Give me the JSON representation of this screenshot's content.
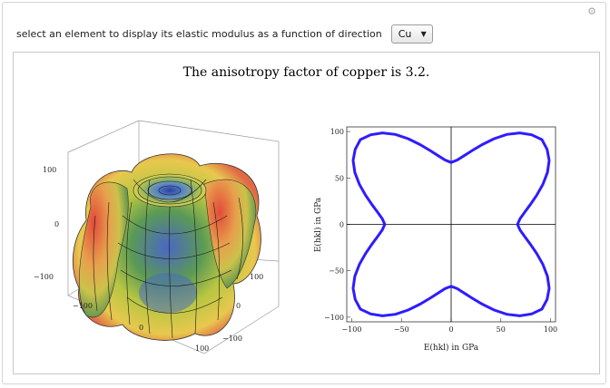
{
  "control": {
    "label": "select an element to display its elastic modulus as a function of direction",
    "element_selected": "Cu"
  },
  "icons": {
    "settings": "gear-icon",
    "dropdown": "chevron-down-icon"
  },
  "title": "The anisotropy factor of copper is 3.2.",
  "surface_plot": {
    "left_ticks": [
      "100",
      "0",
      "−100"
    ],
    "bottom_ticks": [
      "−100",
      "0",
      "100"
    ],
    "right_ticks": [
      "100",
      "0",
      "−100"
    ]
  },
  "chart_data": {
    "type": "line",
    "title": "",
    "xlabel": "E(hkl) in GPa",
    "ylabel": "E(hkl) in GPa",
    "xlim": [
      -105,
      105
    ],
    "ylim": [
      -105,
      105
    ],
    "xticks": [
      "−100",
      "−50",
      "0",
      "50",
      "100"
    ],
    "yticks": [
      "100",
      "50",
      "0",
      "−50",
      "−100"
    ],
    "series": [
      {
        "color": "#2f1cff",
        "points": [
          [
            66.7,
            0
          ],
          [
            69.3,
            6.1
          ],
          [
            73.9,
            13.0
          ],
          [
            79.6,
            21.3
          ],
          [
            86.0,
            31.3
          ],
          [
            92.2,
            43.0
          ],
          [
            96.9,
            56.0
          ],
          [
            98.6,
            69.0
          ],
          [
            96.5,
            80.9
          ],
          [
            91.3,
            91.3
          ],
          [
            80.9,
            96.5
          ],
          [
            69.0,
            98.6
          ],
          [
            56.0,
            96.9
          ],
          [
            43.0,
            92.2
          ],
          [
            31.3,
            86.0
          ],
          [
            21.3,
            79.6
          ],
          [
            13.0,
            73.9
          ],
          [
            6.1,
            69.3
          ],
          [
            0,
            66.7
          ]
        ]
      }
    ],
    "axes_through_origin": true,
    "grid": false
  }
}
